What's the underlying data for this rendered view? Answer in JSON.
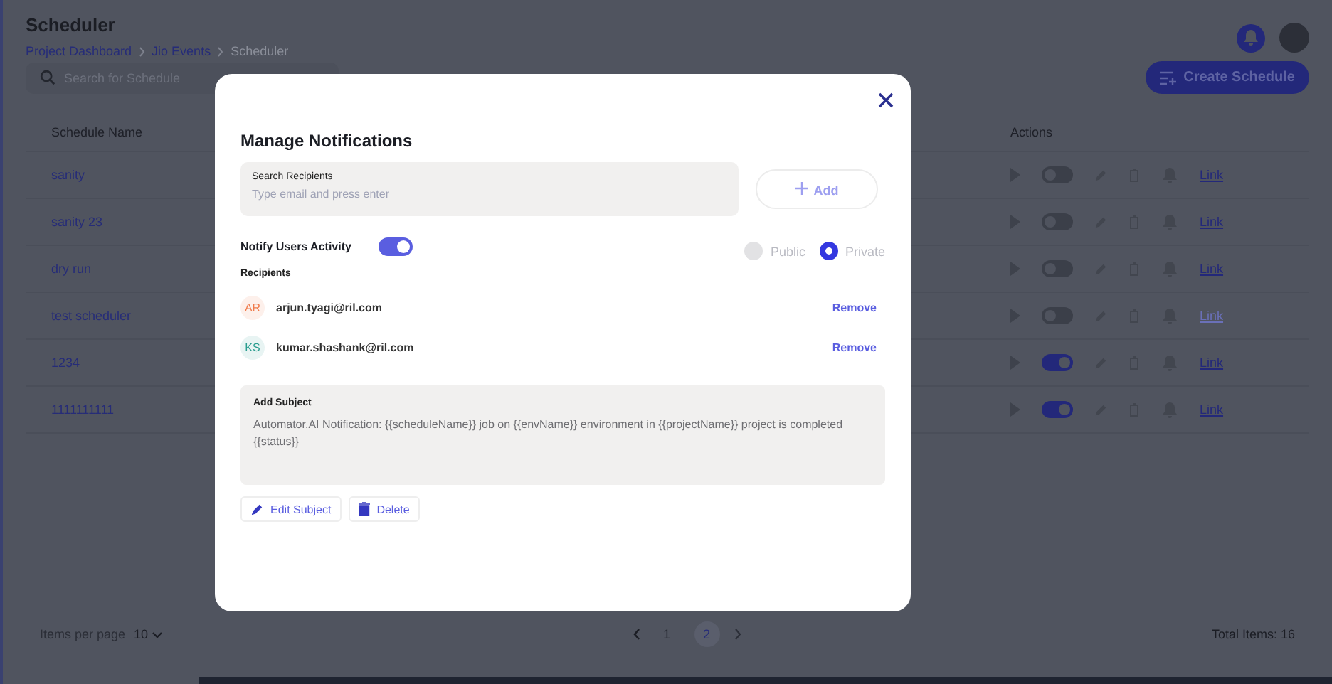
{
  "page": {
    "title": "Scheduler",
    "breadcrumb": [
      {
        "label": "Project Dashboard",
        "selected": false
      },
      {
        "label": "Jio Events",
        "selected": false
      },
      {
        "label": "Scheduler",
        "selected": true
      }
    ],
    "search": {
      "placeholder": "Search for Schedule"
    },
    "create_button": "Create Schedule"
  },
  "table": {
    "columns": [
      "Schedule Name",
      "Actions"
    ],
    "rows": [
      {
        "name": "sanity",
        "on": false,
        "link": "Link",
        "link_disabled": false
      },
      {
        "name": "sanity 23",
        "on": false,
        "link": "Link",
        "link_disabled": false
      },
      {
        "name": "dry run",
        "on": false,
        "link": "Link",
        "link_disabled": false
      },
      {
        "name": "test scheduler",
        "on": false,
        "link": "Link",
        "link_disabled": true
      },
      {
        "name": "1234",
        "on": true,
        "link": "Link",
        "link_disabled": false
      },
      {
        "name": "1111111111",
        "on": true,
        "link": "Link",
        "link_disabled": false
      }
    ]
  },
  "footer": {
    "items_per_page_label": "Items per page",
    "items_per_page": "10",
    "pages": [
      {
        "label": "1",
        "selected": false
      },
      {
        "label": "2",
        "selected": true
      }
    ],
    "total": "Total Items: 16"
  },
  "dialog": {
    "title": "Manage Notifications",
    "search": {
      "label": "Search Recipients",
      "placeholder": "Type email and press enter"
    },
    "add_button": "Add",
    "notify": {
      "label": "Notify Users Activity",
      "on": true
    },
    "visibility": [
      {
        "label": "Public",
        "selected": false
      },
      {
        "label": "Private",
        "selected": true
      }
    ],
    "recipients_label": "Recipients",
    "recipients": [
      {
        "initials": "AR",
        "email": "arjun.tyagi@ril.com",
        "color": "#f07a4a",
        "remove": "Remove"
      },
      {
        "initials": "KS",
        "email": "kumar.shashank@ril.com",
        "color": "#2a9d8f",
        "remove": "Remove"
      }
    ],
    "subject": {
      "label": "Add Subject",
      "text": "Automator.AI Notification: {{scheduleName}} job on {{envName}} environment in {{projectName}} project is completed {{status}}"
    },
    "edit_button": "Edit Subject",
    "delete_button": "Delete"
  }
}
